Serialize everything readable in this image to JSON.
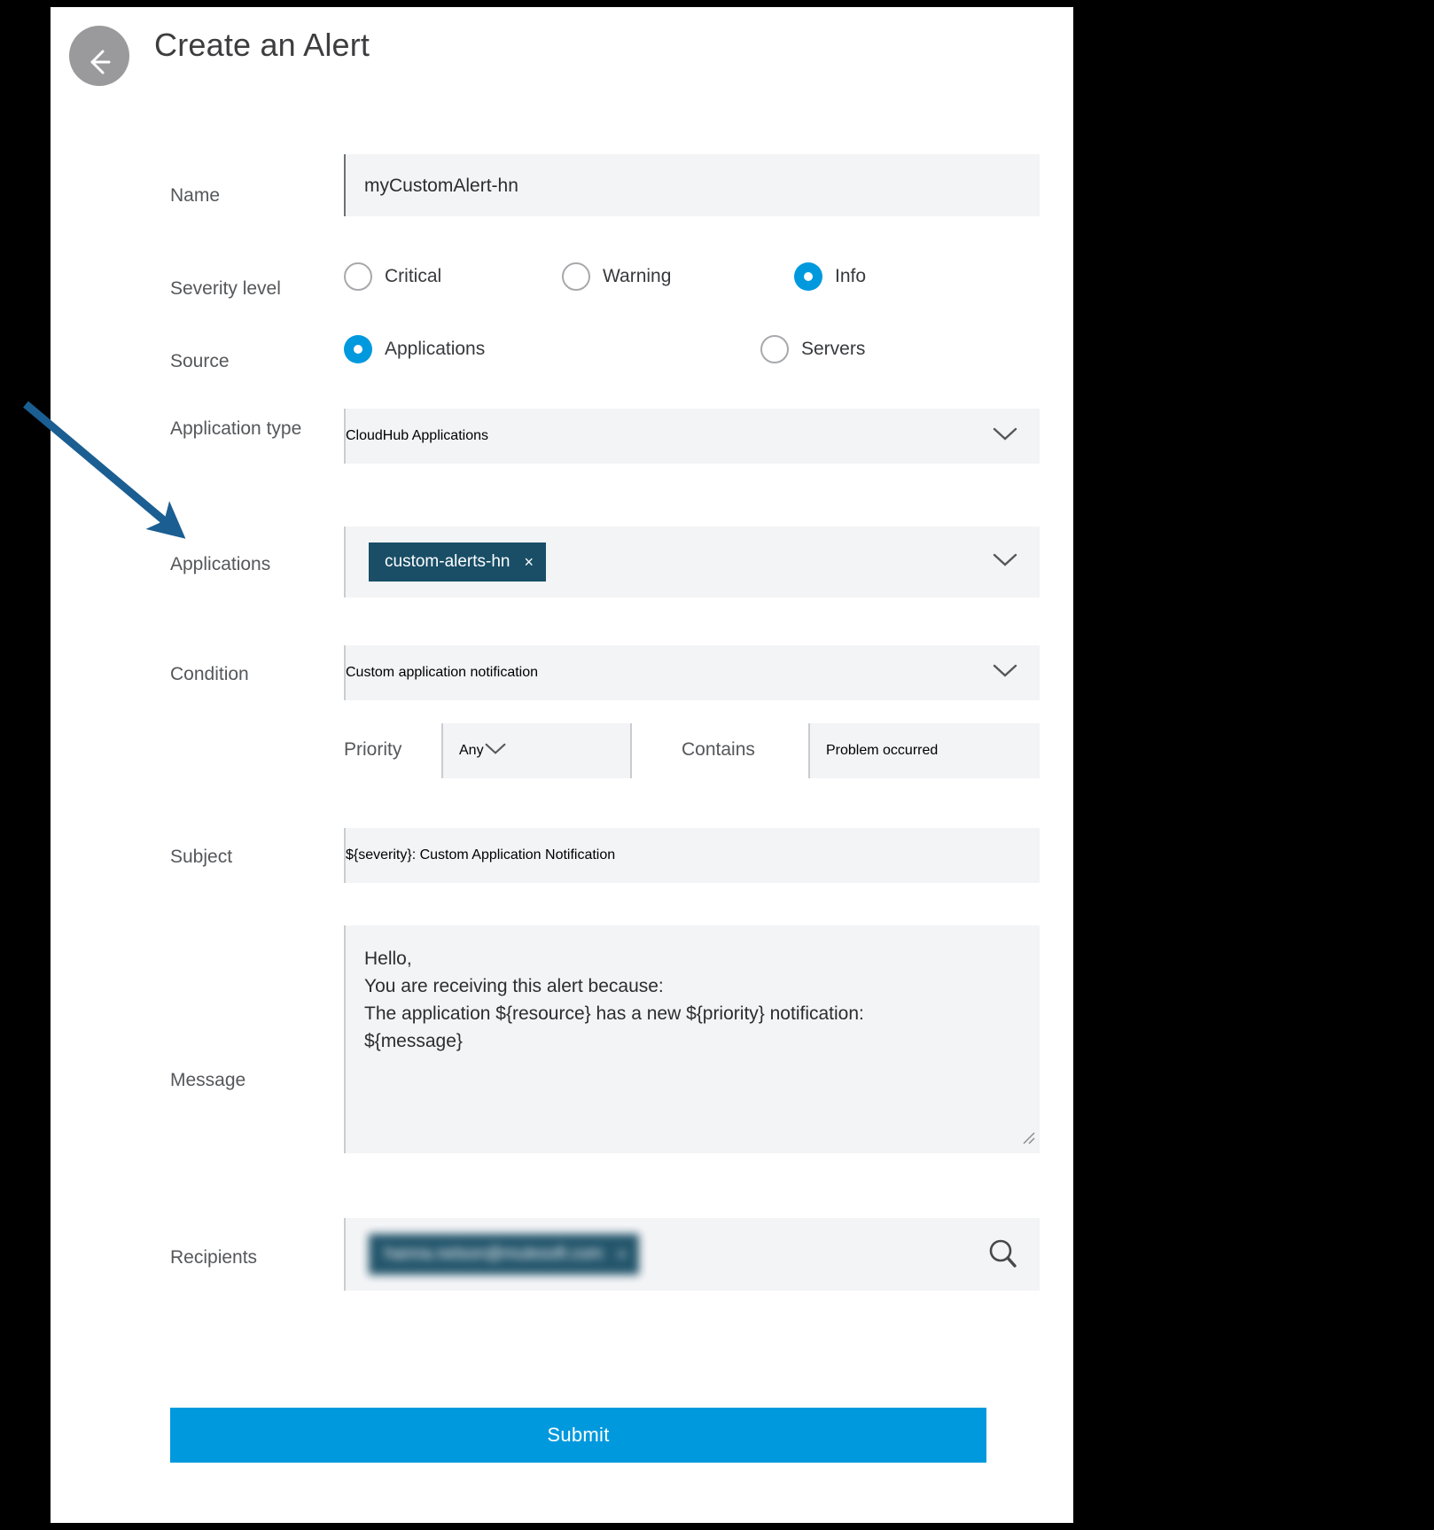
{
  "header": {
    "title": "Create an Alert",
    "back_icon": "arrow-left-icon"
  },
  "form": {
    "name": {
      "label": "Name",
      "value": "myCustomAlert-hn",
      "placeholder": "Name"
    },
    "severity": {
      "label": "Severity level",
      "options": [
        {
          "label": "Critical",
          "selected": false
        },
        {
          "label": "Warning",
          "selected": false
        },
        {
          "label": "Info",
          "selected": true
        }
      ],
      "selected": "Info"
    },
    "source": {
      "label": "Source",
      "options": [
        {
          "label": "Applications",
          "selected": true
        },
        {
          "label": "Servers",
          "selected": false
        }
      ],
      "selected": "Applications"
    },
    "application_type": {
      "label": "Application type",
      "value": "CloudHub Applications",
      "chevron_icon": "chevron-down-icon"
    },
    "applications": {
      "label": "Applications",
      "chips": [
        {
          "text": "custom-alerts-hn",
          "remove_icon": "close-icon",
          "remove_label": "×"
        }
      ],
      "chevron_icon": "chevron-down-icon"
    },
    "condition": {
      "label": "Condition",
      "value": "Custom application notification",
      "chevron_icon": "chevron-down-icon"
    },
    "priority": {
      "label": "Priority",
      "value": "Any",
      "chevron_icon": "chevron-down-icon"
    },
    "contains": {
      "label": "Contains",
      "value": "Problem occurred"
    },
    "subject": {
      "label": "Subject",
      "value": "${severity}: Custom Application Notification"
    },
    "message": {
      "label": "Message",
      "value": "Hello,\nYou are receiving this alert because:\nThe application ${resource} has a new ${priority} notification:\n${message}"
    },
    "recipients": {
      "label": "Recipients",
      "chips": [
        {
          "text": "hanna.nelson@mulesoft.com",
          "remove_label": "×",
          "redacted": true
        }
      ],
      "search_icon": "search-icon"
    },
    "submit": {
      "label": "Submit"
    }
  },
  "annotation": {
    "arrow_icon": "arrow-pointer-icon",
    "points_to": "Applications"
  },
  "colors": {
    "accent": "#0099dd",
    "chip": "#194e66",
    "field_bg": "#f3f4f6",
    "annotation_arrow": "#1b5e92",
    "back_button": "#9a9a9c"
  }
}
